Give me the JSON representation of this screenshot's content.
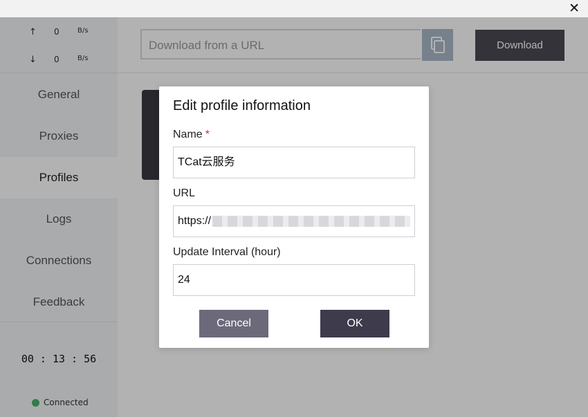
{
  "window": {
    "close_glyph": "✕"
  },
  "sidebar": {
    "traffic": {
      "up": {
        "arrow": "↑",
        "value": "0",
        "unit": "B/s"
      },
      "down": {
        "arrow": "↓",
        "value": "0",
        "unit": "B/s"
      }
    },
    "items": [
      {
        "label": "General"
      },
      {
        "label": "Proxies"
      },
      {
        "label": "Profiles",
        "active": true
      },
      {
        "label": "Logs"
      },
      {
        "label": "Connections"
      },
      {
        "label": "Feedback"
      }
    ],
    "timer": "00 : 13 : 56",
    "status": {
      "label": "Connected",
      "color": "#47b36b"
    }
  },
  "main": {
    "url_input": {
      "placeholder": "Download from a URL"
    },
    "paste_icon": "copy-icon",
    "download_button": "Download"
  },
  "dialog": {
    "title": "Edit profile information",
    "name_label": "Name",
    "required_mark": "*",
    "name_value": "TCat云服务",
    "url_label": "URL",
    "url_value_prefix": "https://",
    "interval_label": "Update Interval (hour)",
    "interval_value": "24",
    "cancel_label": "Cancel",
    "ok_label": "OK"
  }
}
